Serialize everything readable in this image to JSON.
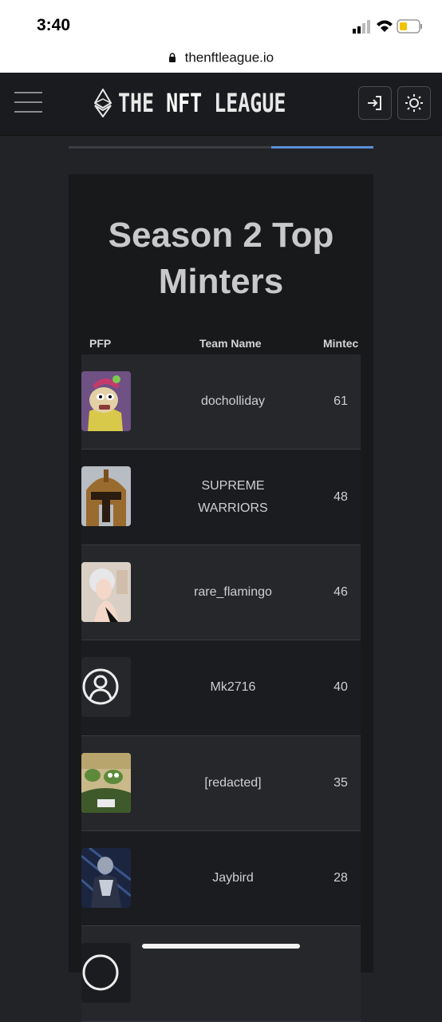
{
  "status": {
    "time": "3:40"
  },
  "browser": {
    "url": "thenftleague.io"
  },
  "nav": {
    "logo_text_pre": "THE ",
    "logo_text_bold": "NFT",
    "logo_text_post": " LEAGUE",
    "login_icon": "login-icon",
    "theme_icon": "sun-icon"
  },
  "page": {
    "title": "Season 2 Top Minters",
    "columns": {
      "pfp": "PFP",
      "team": "Team Name",
      "minted": "Mintec"
    }
  },
  "rows": [
    {
      "team": "docholliday",
      "minted": "61",
      "pfp": "bored-ape-avatar"
    },
    {
      "team": "SUPREME WARRIORS",
      "minted": "48",
      "pfp": "spartan-helmet-avatar"
    },
    {
      "team": "rare_flamingo",
      "minted": "46",
      "pfp": "woman-portrait-avatar"
    },
    {
      "team": "Mk2716",
      "minted": "40",
      "pfp": "default-user-icon"
    },
    {
      "team": "[redacted]",
      "minted": "35",
      "pfp": "pepe-frogs-avatar"
    },
    {
      "team": "Jaybird",
      "minted": "28",
      "pfp": "robot-avatar"
    },
    {
      "team": "",
      "minted": "",
      "pfp": "default-user-icon"
    }
  ]
}
